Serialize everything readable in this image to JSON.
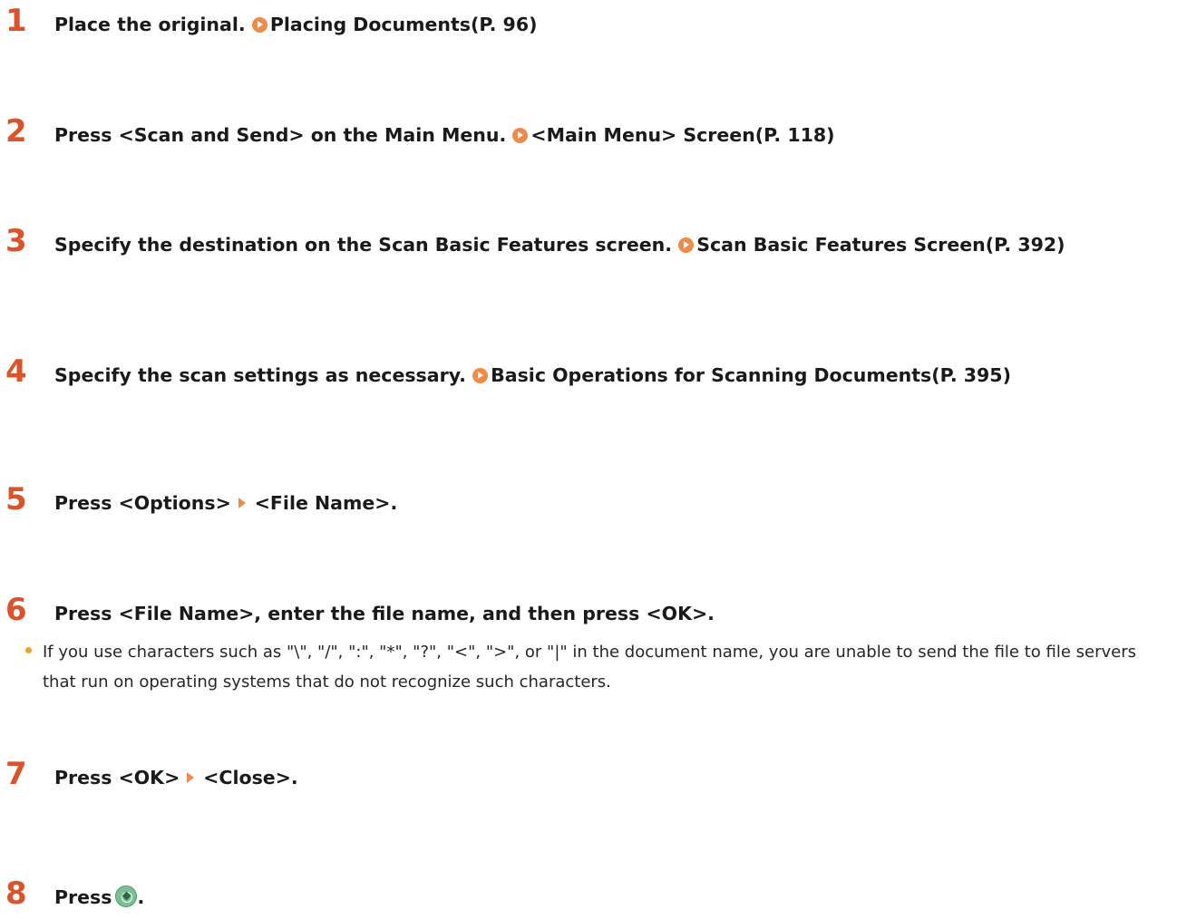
{
  "steps": [
    {
      "num": "1",
      "text": "Place the original.",
      "link": "Placing Documents(P. 96)"
    },
    {
      "num": "2",
      "text": "Press <Scan and Send> on the Main Menu.",
      "link": "<Main Menu> Screen(P. 118)"
    },
    {
      "num": "3",
      "text": "Specify the destination on the Scan Basic Features screen.",
      "link": "Scan Basic Features Screen(P. 392)"
    },
    {
      "num": "4",
      "text": "Specify the scan settings as necessary.",
      "link": "Basic Operations for Scanning Documents(P. 395)"
    },
    {
      "num": "5",
      "part_a": "Press <Options>",
      "part_b": "<File Name>."
    },
    {
      "num": "6",
      "text": "Press <File Name>, enter the file name, and then press <OK>."
    },
    {
      "num": "7",
      "part_a": "Press <OK>",
      "part_b": "<Close>."
    },
    {
      "num": "8",
      "text": "Press",
      "end": "."
    }
  ],
  "note": "If you use characters such as \"\\\", \"/\", \":\", \"*\", \"?\", \"<\", \">\", or \"|\" in the document name, you are unable to send the file to file servers that run on operating systems that do not recognize such characters.",
  "icons": {
    "link_arrow": "circle-arrow-right-icon",
    "separator": "triangle-right-icon",
    "start_key": "start-key-icon"
  },
  "colors": {
    "step_number": "#d9532b",
    "accent": "#f08a4b",
    "start_icon": "#7bbf95"
  }
}
